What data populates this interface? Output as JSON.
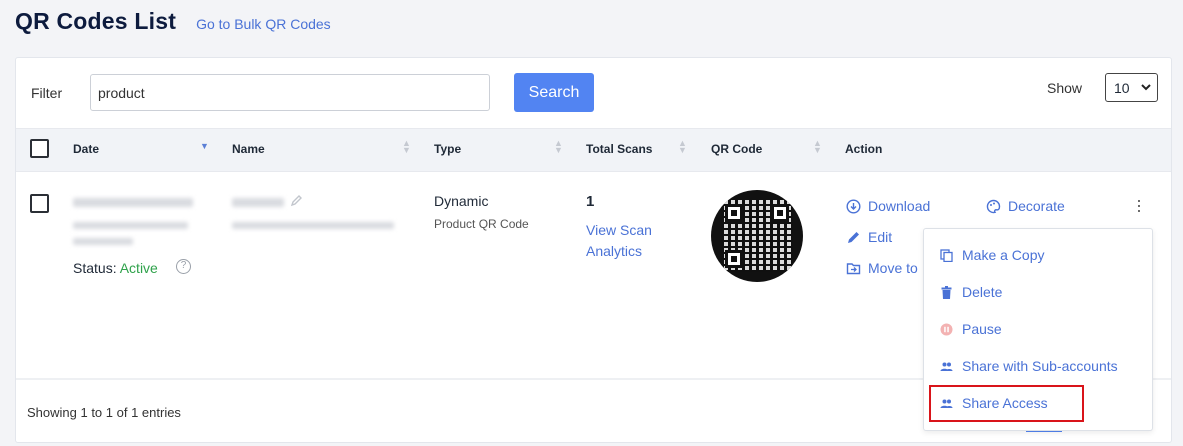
{
  "header": {
    "title": "QR Codes List",
    "bulk_link": "Go to Bulk QR Codes"
  },
  "filter": {
    "label": "Filter",
    "value": "product",
    "search_button": "Search",
    "show_label": "Show",
    "show_value": "10"
  },
  "table": {
    "columns": [
      "Date",
      "Name",
      "Type",
      "Total Scans",
      "QR Code",
      "Action"
    ],
    "rows": [
      {
        "status_label": "Status:",
        "status_value": "Active",
        "type": "Dynamic",
        "type_sub": "Product QR Code",
        "total_scans": "1",
        "scan_link": "View Scan Analytics",
        "actions": {
          "download": "Download",
          "decorate": "Decorate",
          "edit": "Edit",
          "move": "Move to"
        }
      }
    ]
  },
  "menu": {
    "items": [
      "Make a Copy",
      "Delete",
      "Pause",
      "Share with Sub-accounts",
      "Share Access"
    ]
  },
  "footer": {
    "entries": "Showing 1 to 1 of 1 entries"
  },
  "colors": {
    "accent": "#5284f2",
    "link": "#4a72d6",
    "active": "#2fa24b",
    "highlight": "#d9141a"
  }
}
